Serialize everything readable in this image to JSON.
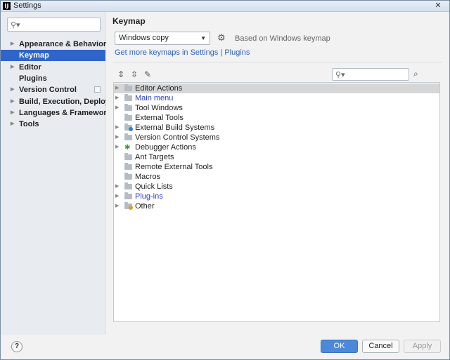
{
  "window": {
    "title": "Settings",
    "app_icon": "IJ",
    "close_glyph": "✕"
  },
  "sidebar": {
    "search_placeholder": "",
    "items": [
      {
        "label": "Appearance & Behavior",
        "expandable": true,
        "selected": false
      },
      {
        "label": "Keymap",
        "expandable": false,
        "selected": true
      },
      {
        "label": "Editor",
        "expandable": true,
        "selected": false
      },
      {
        "label": "Plugins",
        "expandable": false,
        "selected": false
      },
      {
        "label": "Version Control",
        "expandable": true,
        "selected": false
      },
      {
        "label": "Build, Execution, Deployment",
        "expandable": true,
        "selected": false
      },
      {
        "label": "Languages & Frameworks",
        "expandable": true,
        "selected": false
      },
      {
        "label": "Tools",
        "expandable": true,
        "selected": false
      }
    ]
  },
  "main": {
    "title": "Keymap",
    "keymap_select": {
      "value": "Windows copy"
    },
    "based_on": "Based on Windows keymap",
    "link_settings": "Get more keymaps in Settings",
    "link_separator": " | ",
    "link_plugins": "Plugins",
    "filter_placeholder": "",
    "tree": [
      {
        "label": "Editor Actions",
        "expandable": true,
        "selected": true,
        "link": false,
        "icon": "folder-icon",
        "badge": ""
      },
      {
        "label": "Main menu",
        "expandable": true,
        "selected": false,
        "link": true,
        "icon": "folder-icon",
        "badge": ""
      },
      {
        "label": "Tool Windows",
        "expandable": true,
        "selected": false,
        "link": false,
        "icon": "folder-icon",
        "badge": ""
      },
      {
        "label": "External Tools",
        "expandable": false,
        "selected": false,
        "link": false,
        "icon": "folder-icon",
        "badge": ""
      },
      {
        "label": "External Build Systems",
        "expandable": true,
        "selected": false,
        "link": false,
        "icon": "folder-icon",
        "badge": "#3a7fd5"
      },
      {
        "label": "Version Control Systems",
        "expandable": true,
        "selected": false,
        "link": false,
        "icon": "folder-icon",
        "badge": ""
      },
      {
        "label": "Debugger Actions",
        "expandable": true,
        "selected": false,
        "link": false,
        "icon": "bug-icon",
        "badge": ""
      },
      {
        "label": "Ant Targets",
        "expandable": false,
        "selected": false,
        "link": false,
        "icon": "folder-icon",
        "badge": ""
      },
      {
        "label": "Remote External Tools",
        "expandable": false,
        "selected": false,
        "link": false,
        "icon": "folder-icon",
        "badge": ""
      },
      {
        "label": "Macros",
        "expandable": false,
        "selected": false,
        "link": false,
        "icon": "folder-icon",
        "badge": ""
      },
      {
        "label": "Quick Lists",
        "expandable": true,
        "selected": false,
        "link": false,
        "icon": "folder-icon",
        "badge": ""
      },
      {
        "label": "Plug-ins",
        "expandable": true,
        "selected": false,
        "link": true,
        "icon": "folder-icon",
        "badge": ""
      },
      {
        "label": "Other",
        "expandable": true,
        "selected": false,
        "link": false,
        "icon": "folder-icon",
        "badge": "#e0a020"
      }
    ]
  },
  "footer": {
    "help": "?",
    "ok": "OK",
    "cancel": "Cancel",
    "apply": "Apply"
  },
  "colors": {
    "accent": "#2f65ca",
    "link": "#2a62c4",
    "ok_button": "#4a8ad8"
  }
}
